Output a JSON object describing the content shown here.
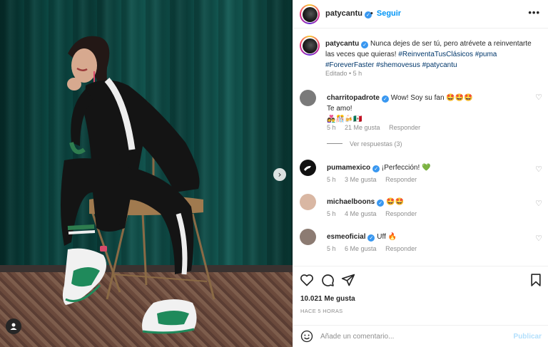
{
  "post": {
    "username": "patycantu",
    "follow_label": "Seguir",
    "more_label": "•••",
    "dot": "•"
  },
  "caption": {
    "username": "patycantu",
    "text_1": "Nunca dejes de ser tú, pero atrévete a reinventarte las veces que quieras!",
    "hashtag_1": "#ReinventaTusClásicos",
    "hashtag_2": "#puma",
    "hashtag_3": "#ForeverFaster",
    "hashtag_4": "#shemovesus",
    "hashtag_5": "#patycantu",
    "edited": "Editado • 5 h"
  },
  "comments": [
    {
      "username": "charritopadrote",
      "text": "Wow! Soy su fan 🤩🤩🤩",
      "text_2": "Te amo!",
      "text_3": "👩‍❤️‍👨🎊🍻🇲🇽",
      "time": "5 h",
      "likes": "21 Me gusta",
      "reply": "Responder",
      "avatar_color": "#7a7a7a"
    },
    {
      "username": "pumamexico",
      "text": "¡Perfección! 💚",
      "time": "5 h",
      "likes": "3 Me gusta",
      "reply": "Responder",
      "avatar_color": "#111111"
    },
    {
      "username": "michaelboons",
      "text": "🤩🤩",
      "time": "5 h",
      "likes": "4 Me gusta",
      "reply": "Responder",
      "avatar_color": "#d9b7a3"
    },
    {
      "username": "esmeoficial",
      "text": "Uff 🔥",
      "time": "5 h",
      "likes": "6 Me gusta",
      "reply": "Responder",
      "avatar_color": "#8c7b72"
    }
  ],
  "view_replies": "Ver respuestas (3)",
  "stats": {
    "likes": "10.021 Me gusta",
    "time_ago": "HACE 5 HORAS"
  },
  "comment_box": {
    "placeholder": "Añade un comentario...",
    "publish_label": "Publicar"
  },
  "icons": {
    "heart": "heart-icon",
    "comment": "comment-icon",
    "share": "share-icon",
    "save": "bookmark-icon",
    "emoji": "emoji-icon",
    "next": "chevron-right-icon",
    "tag": "user-tag-icon"
  },
  "colors": {
    "accent": "#0095f6",
    "verified": "#3897f0",
    "hashtag": "#00376b",
    "muted": "#8e8e8e",
    "curtain": "#0c4a45"
  }
}
